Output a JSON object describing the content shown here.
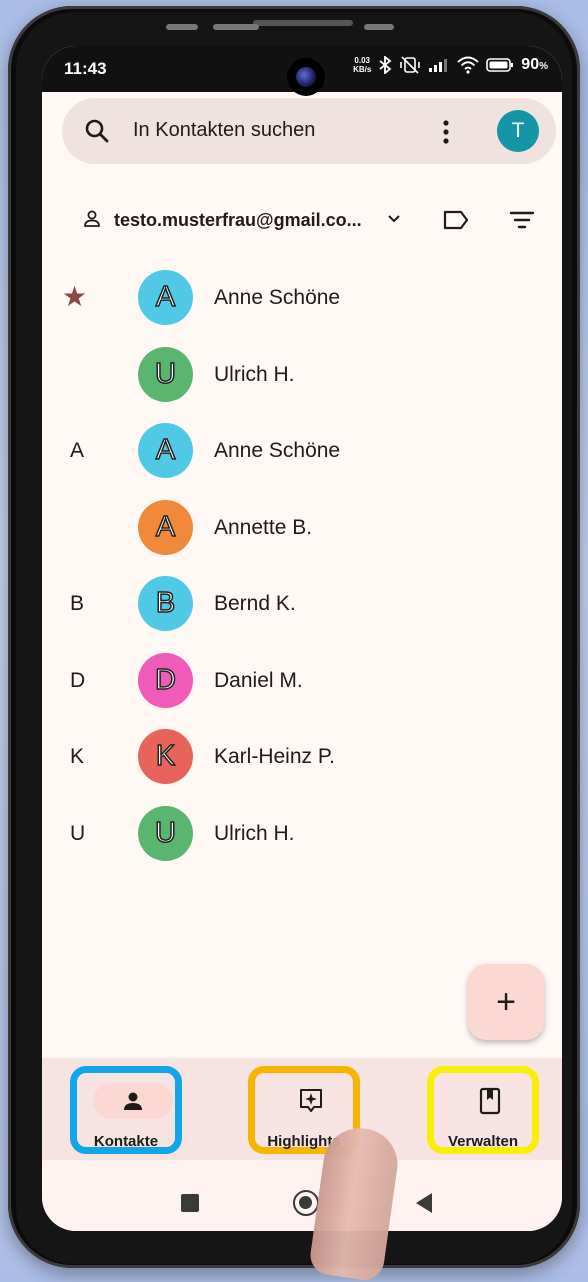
{
  "status_bar": {
    "time": "11:43",
    "net_speed_value": "0.03",
    "net_speed_unit": "KB/s",
    "battery": "90",
    "battery_unit": "%"
  },
  "search": {
    "placeholder": "In Kontakten suchen",
    "avatar_letter": "T",
    "avatar_color": "#1397a7"
  },
  "account": {
    "email": "testo.musterfrau@gmail.co..."
  },
  "contacts": [
    {
      "section": "",
      "starred": true,
      "initial": "A",
      "name": "Anne Schöne",
      "color": "#4fc9e6"
    },
    {
      "section": "",
      "starred": false,
      "initial": "U",
      "name": "Ulrich H.",
      "color": "#5ab56f"
    },
    {
      "section": "A",
      "starred": false,
      "initial": "A",
      "name": "Anne Schöne",
      "color": "#4fc9e6"
    },
    {
      "section": "",
      "starred": false,
      "initial": "A",
      "name": "Annette B.",
      "color": "#f08a3a"
    },
    {
      "section": "B",
      "starred": false,
      "initial": "B",
      "name": "Bernd K.",
      "color": "#4fc9e6"
    },
    {
      "section": "D",
      "starred": false,
      "initial": "D",
      "name": "Daniel M.",
      "color": "#f05bb8"
    },
    {
      "section": "K",
      "starred": false,
      "initial": "K",
      "name": "Karl-Heinz P.",
      "color": "#e6645a"
    },
    {
      "section": "U",
      "starred": false,
      "initial": "U",
      "name": "Ulrich H.",
      "color": "#5ab56f"
    }
  ],
  "fab": {
    "label": "+"
  },
  "bottom_nav": [
    {
      "label": "Kontakte",
      "icon": "person-icon",
      "active": true,
      "highlight": "#10a7ea"
    },
    {
      "label": "Highlights",
      "icon": "highlights-icon",
      "active": false,
      "highlight": "#f7b500"
    },
    {
      "label": "Verwalten",
      "icon": "bookmark-book-icon",
      "active": false,
      "highlight": "#f8ee0a"
    }
  ],
  "colors": {
    "background": "#fff8f5",
    "search_bg": "#f0e2df",
    "nav_bg": "#f7e4e2",
    "nav_active_pill": "#fcd8d3",
    "star": "#8a4a44"
  }
}
